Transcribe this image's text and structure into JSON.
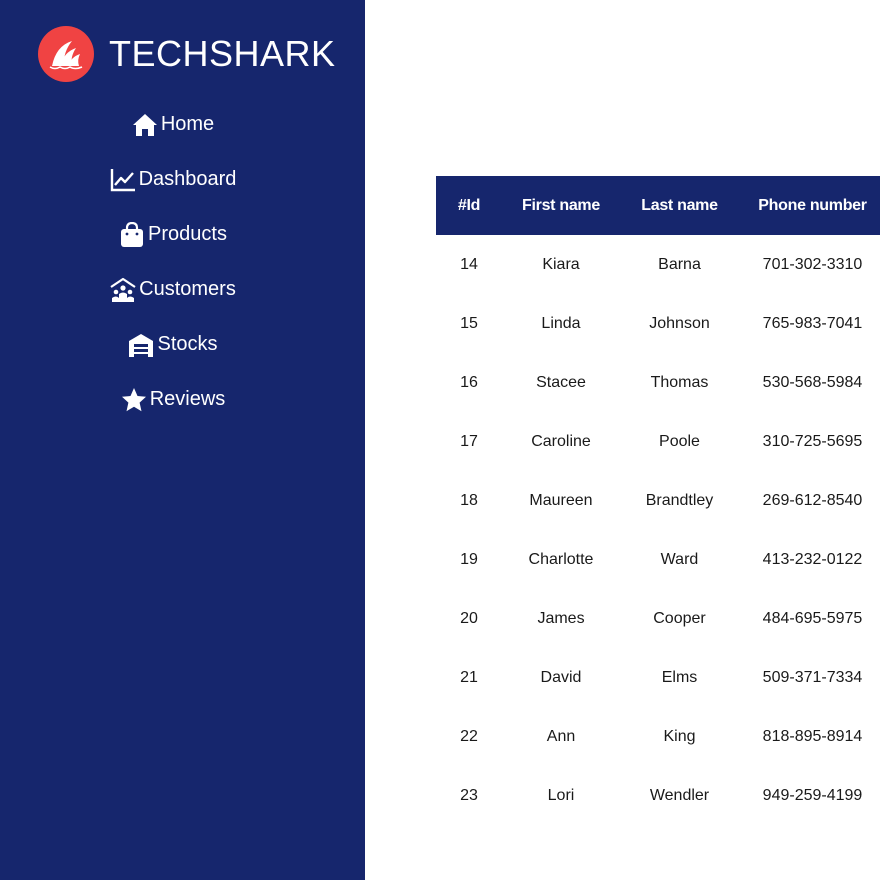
{
  "brand": {
    "name": "TECHSHARK",
    "logo_color": "#f04343"
  },
  "colors": {
    "sidebar_bg": "#16266d",
    "header_bg": "#16266d",
    "text_light": "#ffffff",
    "text_dark": "#1a1a1a"
  },
  "sidebar": {
    "items": [
      {
        "label": "Home",
        "icon": "home-icon"
      },
      {
        "label": "Dashboard",
        "icon": "chart-line-icon"
      },
      {
        "label": "Products",
        "icon": "shopping-bag-icon"
      },
      {
        "label": "Customers",
        "icon": "people-roof-icon"
      },
      {
        "label": "Stocks",
        "icon": "warehouse-icon"
      },
      {
        "label": "Reviews",
        "icon": "star-icon"
      }
    ]
  },
  "table": {
    "headers": [
      "#Id",
      "First name",
      "Last name",
      "Phone number"
    ],
    "rows": [
      [
        "14",
        "Kiara",
        "Barna",
        "701-302-3310"
      ],
      [
        "15",
        "Linda",
        "Johnson",
        "765-983-7041"
      ],
      [
        "16",
        "Stacee",
        "Thomas",
        "530-568-5984"
      ],
      [
        "17",
        "Caroline",
        "Poole",
        "310-725-5695"
      ],
      [
        "18",
        "Maureen",
        "Brandtley",
        "269-612-8540"
      ],
      [
        "19",
        "Charlotte",
        "Ward",
        "413-232-0122"
      ],
      [
        "20",
        "James",
        "Cooper",
        "484-695-5975"
      ],
      [
        "21",
        "David",
        "Elms",
        "509-371-7334"
      ],
      [
        "22",
        "Ann",
        "King",
        "818-895-8914"
      ],
      [
        "23",
        "Lori",
        "Wendler",
        "949-259-4199"
      ]
    ]
  }
}
